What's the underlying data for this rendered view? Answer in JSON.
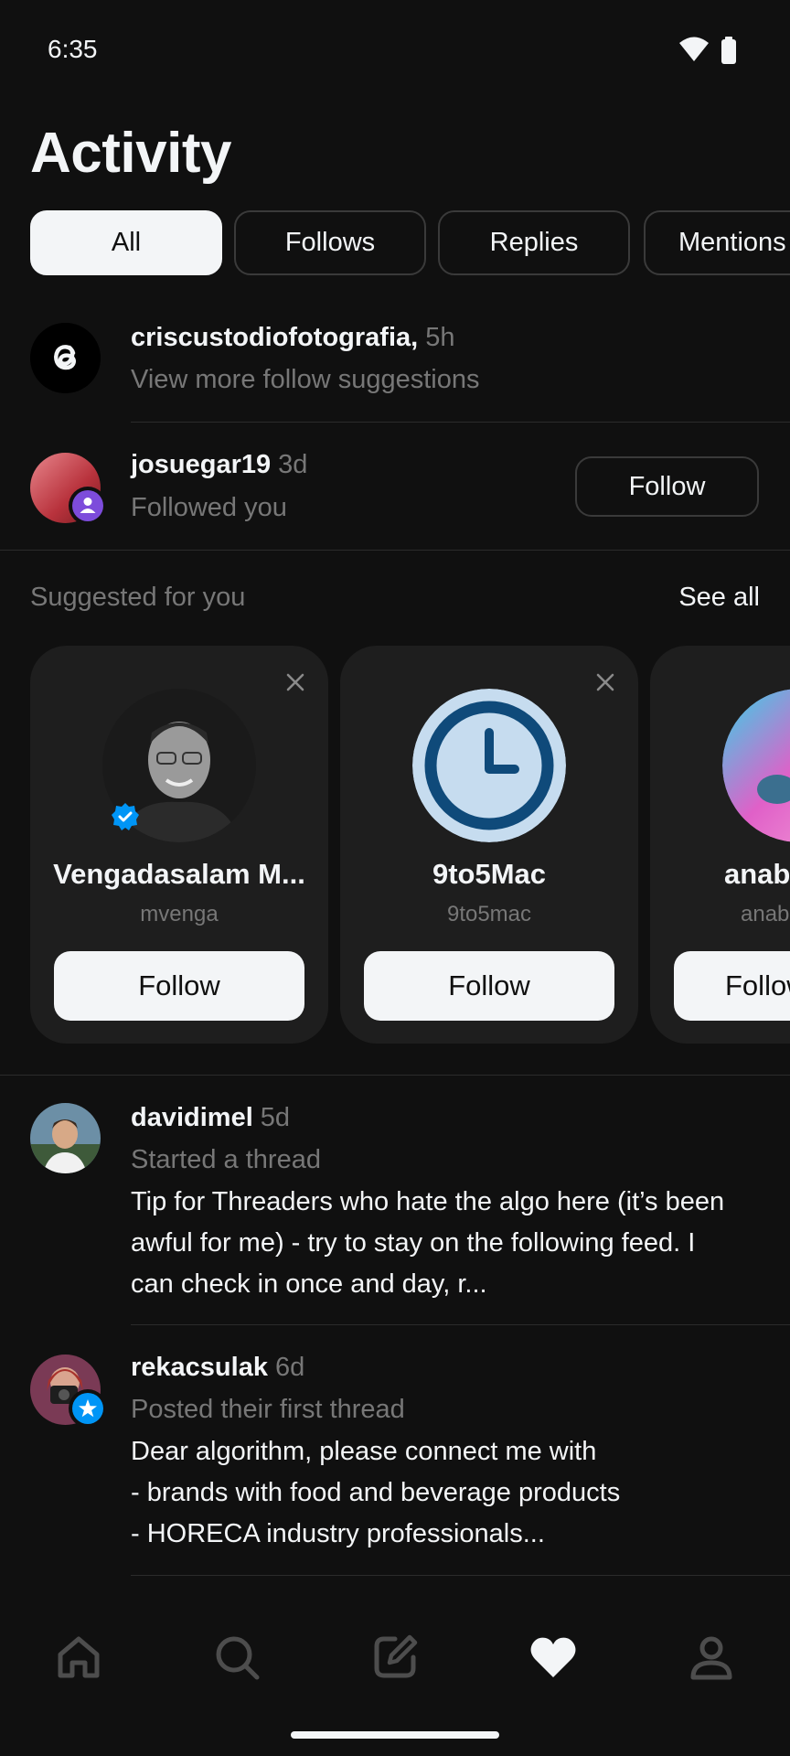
{
  "status_bar": {
    "time": "6:35"
  },
  "header": {
    "title": "Activity"
  },
  "tabs": [
    {
      "label": "All",
      "active": true
    },
    {
      "label": "Follows",
      "active": false
    },
    {
      "label": "Replies",
      "active": false
    },
    {
      "label": "Mentions",
      "active": false
    }
  ],
  "notifications": [
    {
      "user": "criscustodiofotografia,",
      "time": "5h",
      "text": "View more follow suggestions",
      "avatar": "threads-logo-icon"
    },
    {
      "user": "josuegar19",
      "time": "3d",
      "text": "Followed you",
      "button": "Follow",
      "badge": "person-badge-icon"
    }
  ],
  "suggested": {
    "label": "Suggested for you",
    "see_all": "See all",
    "cards": [
      {
        "name": "Vengadasalam M...",
        "handle": "mvenga",
        "follow": "Follow",
        "verified": true
      },
      {
        "name": "9to5Mac",
        "handle": "9to5mac",
        "follow": "Follow",
        "verified": false
      },
      {
        "name": "anabe",
        "handle": "anab",
        "follow": "Follow",
        "verified": false
      }
    ]
  },
  "threads": [
    {
      "user": "davidimel",
      "time": "5d",
      "subtitle": "Started a thread",
      "body": "Tip for Threaders who hate the algo here (it’s been awful for me) - try to stay on the following feed. I can check in once and day, r..."
    },
    {
      "user": "rekacsulak",
      "time": "6d",
      "subtitle": "Posted their first thread",
      "body_lines": [
        "Dear algorithm, please connect me with",
        "- brands with food and beverage products",
        "- HORECA industry professionals..."
      ],
      "badge": "star-badge-icon"
    }
  ],
  "nav": [
    "home-icon",
    "search-icon",
    "compose-icon",
    "heart-icon",
    "profile-icon"
  ],
  "colors": {
    "background": "#101010",
    "text": "#f3f5f7",
    "secondary": "#777777",
    "card": "#1e1e1e",
    "verified": "#0095f6",
    "badge_purple": "#7d4cdb"
  }
}
